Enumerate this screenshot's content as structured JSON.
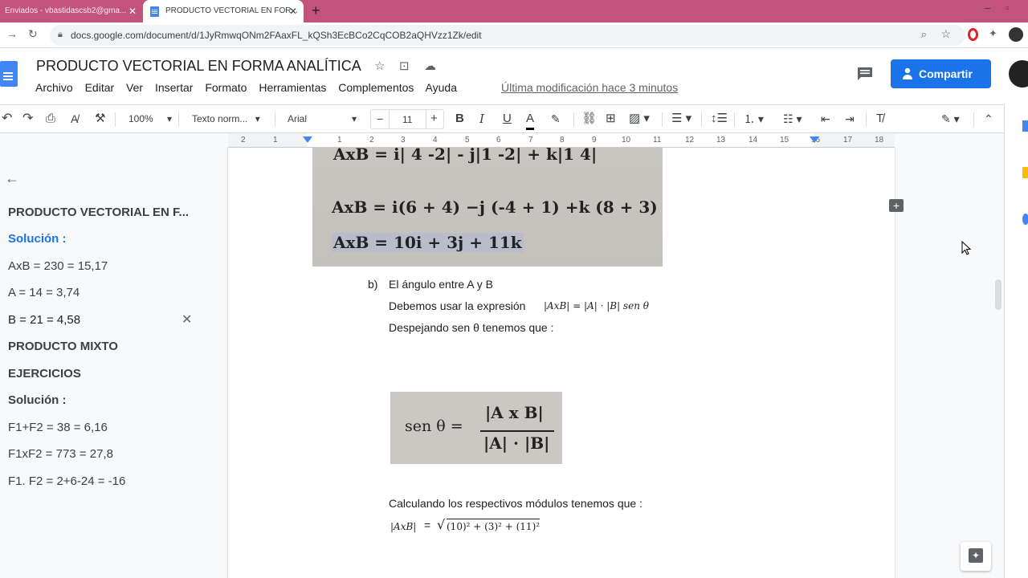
{
  "browser": {
    "tabs": [
      {
        "label": "Enviados - vbastidascsb2@gma..."
      },
      {
        "label": "PRODUCTO VECTORIAL EN FOR..."
      }
    ],
    "new_tab": "+",
    "url": "docs.google.com/document/d/1JyRmwqONm2FAaxFL_kQSh3EcBCo2CqCOB2aQHVzz1Zk/edit"
  },
  "docs": {
    "title": "PRODUCTO VECTORIAL EN FORMA ANALÍTICA",
    "menu": [
      "Archivo",
      "Editar",
      "Ver",
      "Insertar",
      "Formato",
      "Herramientas",
      "Complementos",
      "Ayuda"
    ],
    "last_modified": "Última modificación hace 3 minutos",
    "share_label": "Compartir"
  },
  "toolbar": {
    "zoom": "100%",
    "style": "Texto norm...",
    "font": "Arial",
    "font_size": "11",
    "minus": "−",
    "plus": "+",
    "bold": "B",
    "italic": "I",
    "underline": "U",
    "text_color": "A"
  },
  "outline": {
    "items": [
      {
        "label": "PRODUCTO VECTORIAL EN F...",
        "style": "bold"
      },
      {
        "label": "Solución :",
        "style": "active"
      },
      {
        "label": "AxB = 230 = 15,17",
        "style": "normal"
      },
      {
        "label": "A = 14 = 3,74",
        "style": "normal"
      },
      {
        "label": "B = 21 = 4,58",
        "style": "current"
      },
      {
        "label": "PRODUCTO MIXTO",
        "style": "bold"
      },
      {
        "label": "EJERCICIOS",
        "style": "bold"
      },
      {
        "label": "Solución :",
        "style": "bold"
      },
      {
        "label": "F1+F2 = 38 = 6,16",
        "style": "normal"
      },
      {
        "label": "F1xF2 = 773 = 27,8",
        "style": "normal"
      },
      {
        "label": "F1. F2 = 2+6-24 = -16",
        "style": "normal"
      }
    ]
  },
  "ruler": {
    "numbers": [
      "2",
      "1",
      "1",
      "2",
      "3",
      "4",
      "5",
      "6",
      "7",
      "8",
      "9",
      "10",
      "11",
      "12",
      "13",
      "14",
      "15",
      "16",
      "17",
      "18"
    ]
  },
  "document": {
    "image1": {
      "line1": "AxB = i|  4     -2| - j|1    -2| + k|1     4|",
      "line2": "AxB = i(6 + 4) −j (-4  + 1) +k (8 + 3)",
      "line3": "AxB = 10i + 3j + 11k"
    },
    "item_b_marker": "b)",
    "item_b_title": "El ángulo entre A y B",
    "expr_intro": "Debemos usar la expresión",
    "expr_formula": "|AxB| = |A| · |B| sen θ",
    "clear_text": "Despejando sen  θ  tenemos que :",
    "image2": {
      "lhs": "sen θ =",
      "numerator": "|A x B|",
      "denominator": "|A| · |B|"
    },
    "calc_text": "Calculando los respectivos módulos tenemos que :",
    "modulus_lhs": "|AxB|",
    "modulus_eq": "=",
    "modulus_rhs": "(10)² + (3)² + (11)²"
  }
}
